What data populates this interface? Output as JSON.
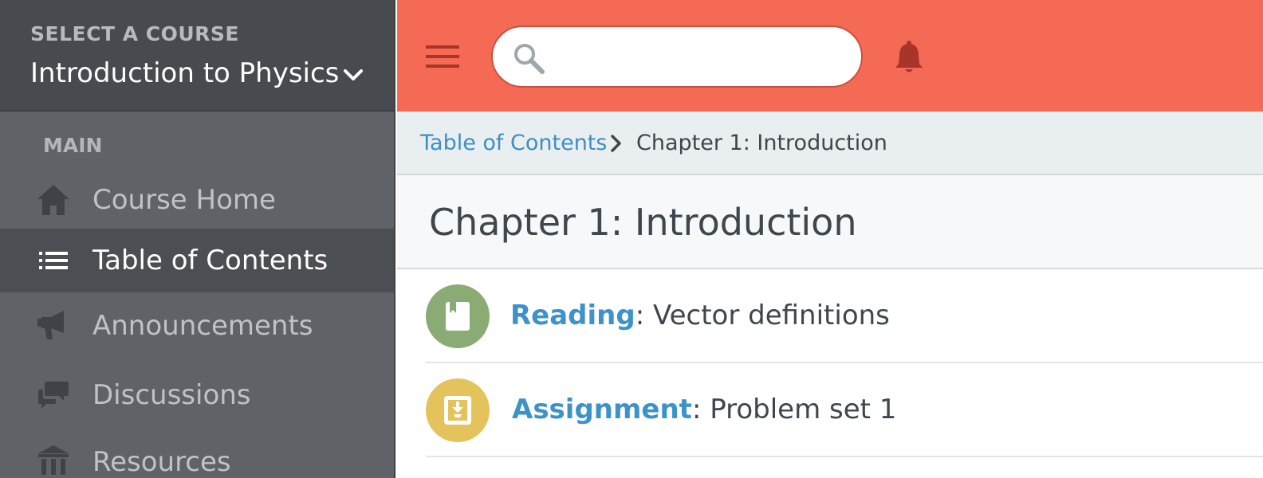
{
  "sidebar": {
    "course_label": "SELECT A COURSE",
    "course_name": "Introduction to Physics",
    "section_label": "MAIN",
    "items": [
      {
        "label": "Course Home",
        "icon": "home-icon"
      },
      {
        "label": "Table of Contents",
        "icon": "list-icon",
        "active": true
      },
      {
        "label": "Announcements",
        "icon": "megaphone-icon"
      },
      {
        "label": "Discussions",
        "icon": "chat-bubbles-icon"
      },
      {
        "label": "Resources",
        "icon": "bank-icon"
      }
    ]
  },
  "topbar": {
    "search_placeholder": "",
    "search_value": "",
    "colors": {
      "bar": "#f56a55",
      "icons": "#a8342a"
    }
  },
  "breadcrumb": {
    "link": "Table of Contents",
    "current": "Chapter 1: Introduction"
  },
  "page": {
    "title": "Chapter 1: Introduction"
  },
  "items": [
    {
      "type": "Reading",
      "sep": ": ",
      "title": "Vector definitions",
      "icon": "book-icon",
      "color": "#8bab74"
    },
    {
      "type": "Assignment",
      "sep": ": ",
      "title": "Problem set 1",
      "icon": "inbox-download-icon",
      "color": "#e5c35c"
    }
  ]
}
